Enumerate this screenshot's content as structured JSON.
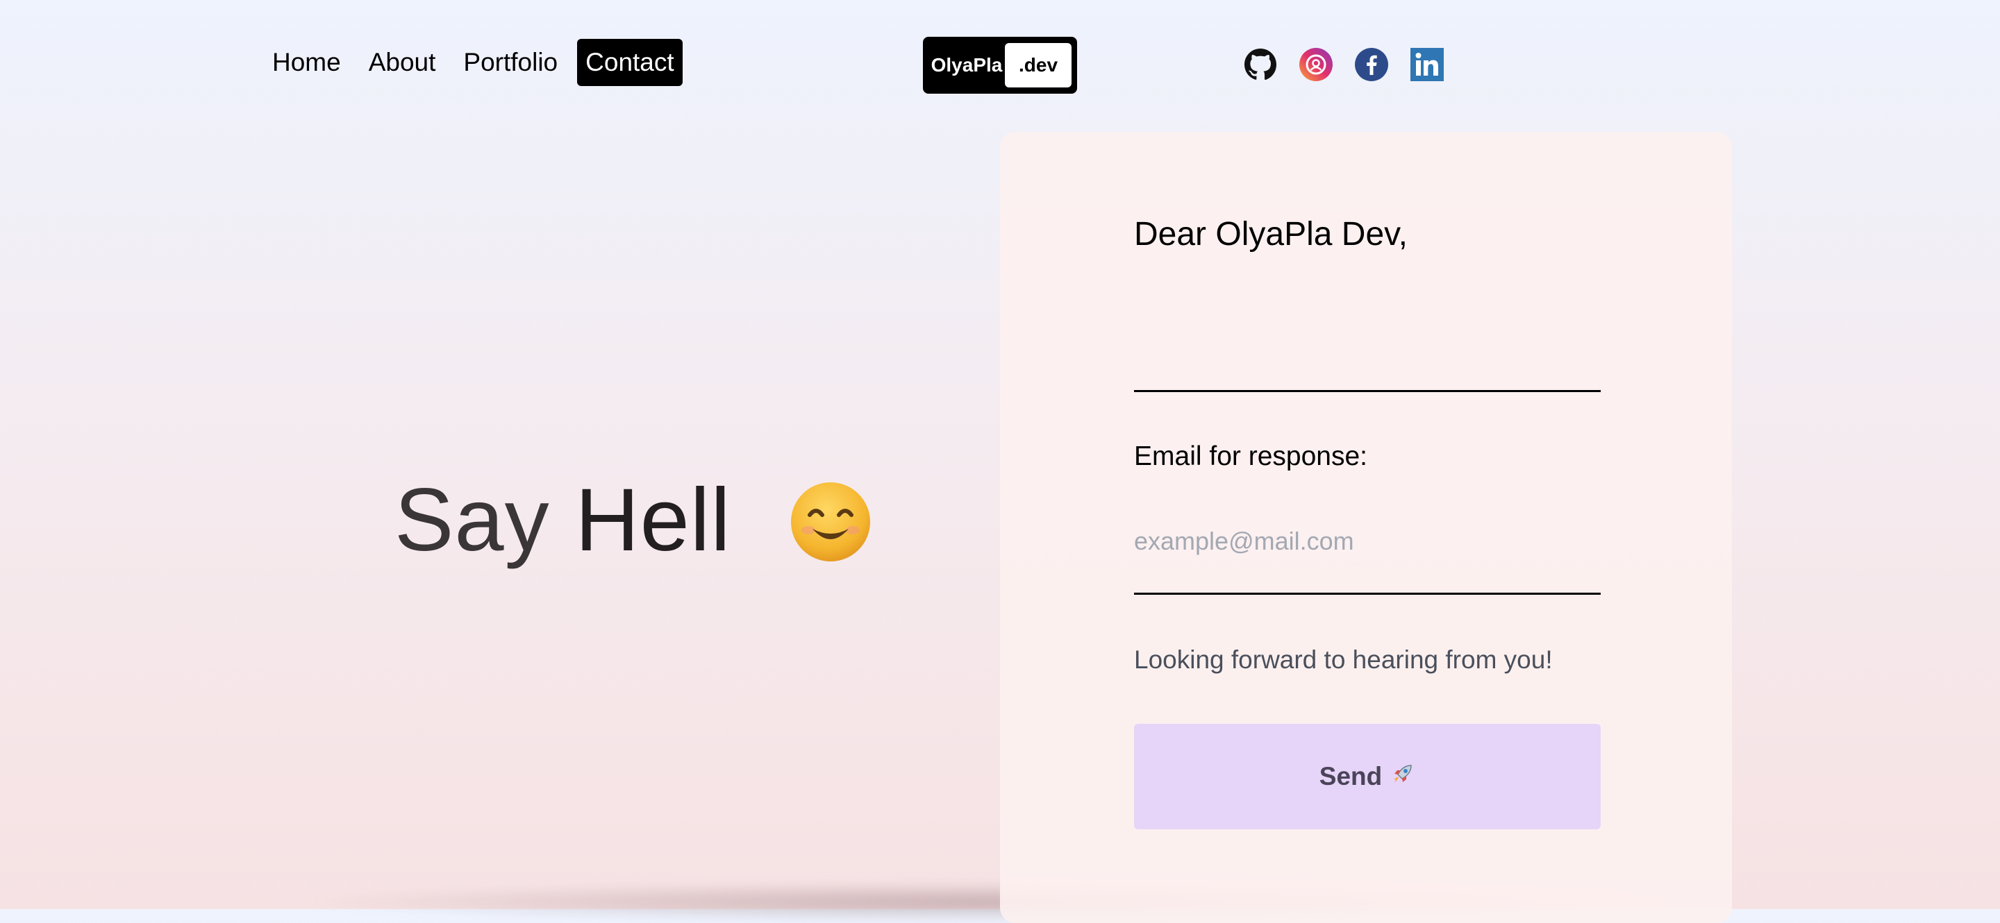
{
  "nav": {
    "items": [
      {
        "label": "Home"
      },
      {
        "label": "About"
      },
      {
        "label": "Portfolio"
      },
      {
        "label": "Contact"
      }
    ]
  },
  "logo": {
    "part1": "OlyaPla",
    "part2": ".dev"
  },
  "social": [
    "github-icon",
    "instagram-icon",
    "facebook-icon",
    "linkedin-icon"
  ],
  "hero": {
    "word1": "Say ",
    "word2": "Hell",
    "emoji": "smiling-face-emoji"
  },
  "form": {
    "greeting": "Dear OlyaPla Dev,",
    "message_value": "",
    "email_label": "Email for response:",
    "email_placeholder": "example@mail.com",
    "closing": "Looking forward to hearing from you!",
    "send_label": "Send"
  },
  "colors": {
    "accent": "#000000",
    "send_bg": "#e6d5f8"
  }
}
